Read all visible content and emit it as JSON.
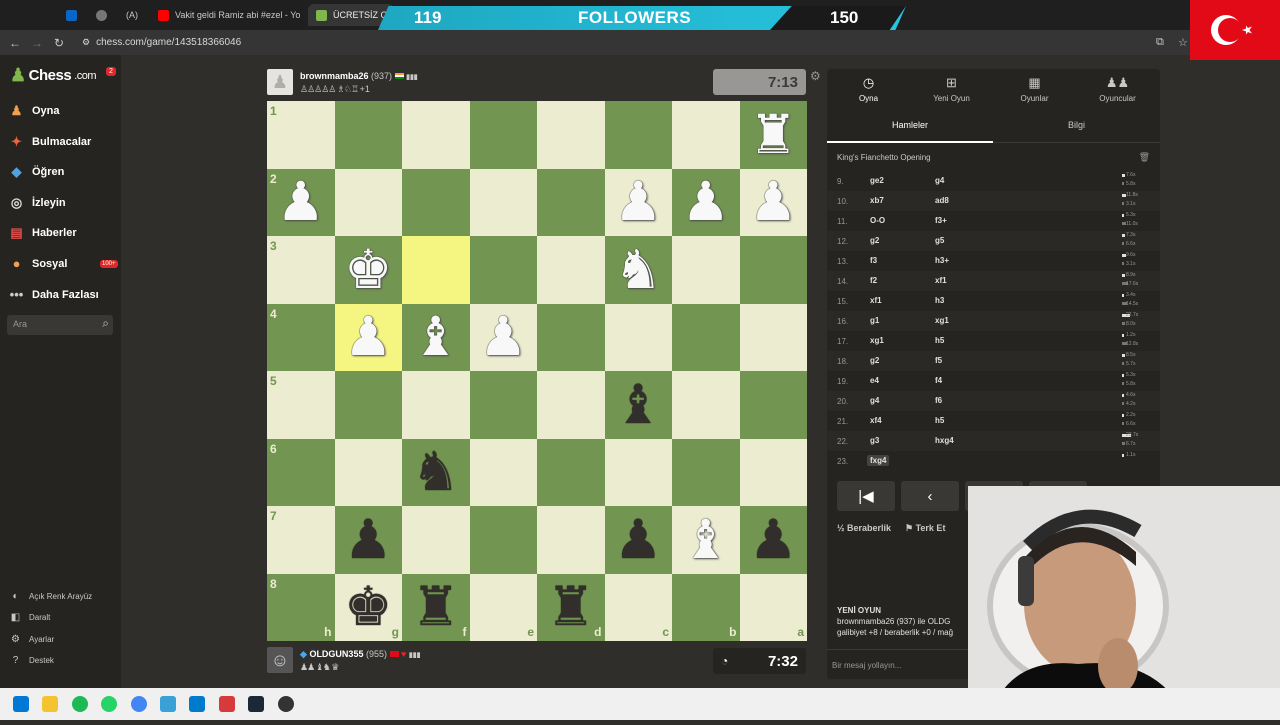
{
  "browser": {
    "tabs": [
      {
        "label": "",
        "icon": "linkedin-icon",
        "color": "#0a66c2"
      },
      {
        "label": "",
        "icon": "globe-icon",
        "color": "#777777"
      },
      {
        "label": "(A)",
        "icon": "app-icon",
        "color": "#6d4cc2"
      },
      {
        "label": "Vakit geldi Ramiz abi #ezel - Yo",
        "icon": "youtube-icon",
        "color": "#ff0000"
      },
      {
        "label": "ÜCRETSİZ Çevrimiçi",
        "icon": "chess-icon",
        "color": "#81b64c"
      }
    ],
    "url": "chess.com/game/143518366046"
  },
  "overlay": {
    "left_count": "119",
    "title": "FOLLOWERS",
    "right_count": "150"
  },
  "sidebar": {
    "logo_text": "Chess",
    "logo_suffix": ".com",
    "notification_count": "2",
    "items": [
      {
        "label": "Oyna",
        "icon": "play-icon"
      },
      {
        "label": "Bulmacalar",
        "icon": "puzzle-icon"
      },
      {
        "label": "Öğren",
        "icon": "learn-icon"
      },
      {
        "label": "İzleyin",
        "icon": "binoculars-icon"
      },
      {
        "label": "Haberler",
        "icon": "news-icon"
      },
      {
        "label": "Sosyal",
        "icon": "social-icon"
      },
      {
        "label": "Daha Fazlası",
        "icon": "more-icon"
      }
    ],
    "social_badge": "100+",
    "search_placeholder": "Ara",
    "bottom": [
      {
        "label": "Açık Renk Arayüz",
        "icon": "theme-icon"
      },
      {
        "label": "Daralt",
        "icon": "collapse-icon"
      },
      {
        "label": "Ayarlar",
        "icon": "settings-icon"
      },
      {
        "label": "Destek",
        "icon": "help-icon"
      }
    ]
  },
  "top_player": {
    "name": "brownmamba26",
    "rating": "(937)",
    "captured_suffix": "+1",
    "clock": "7:13"
  },
  "bottom_player": {
    "name": "OLDGUN355",
    "rating": "(955)",
    "clock": "7:32"
  },
  "board": {
    "ranks": [
      "1",
      "2",
      "3",
      "4",
      "5",
      "6",
      "7",
      "8"
    ],
    "files": [
      "h",
      "g",
      "f",
      "e",
      "d",
      "c",
      "b",
      "a"
    ],
    "highlight_color": "#f5f682",
    "light_color": "#ebecd0",
    "dark_color": "#739552",
    "pieces": [
      {
        "square": "a1",
        "piece": "R",
        "color": "white"
      },
      {
        "square": "c2",
        "piece": "P",
        "color": "white"
      },
      {
        "square": "b2",
        "piece": "P",
        "color": "white"
      },
      {
        "square": "a2",
        "piece": "P",
        "color": "white"
      },
      {
        "square": "h2",
        "piece": "P",
        "color": "white"
      },
      {
        "square": "g3",
        "piece": "K",
        "color": "white"
      },
      {
        "square": "c3",
        "piece": "N",
        "color": "white"
      },
      {
        "square": "g4",
        "piece": "P",
        "color": "white"
      },
      {
        "square": "f4",
        "piece": "B",
        "color": "white"
      },
      {
        "square": "e4",
        "piece": "P",
        "color": "white"
      },
      {
        "square": "c5",
        "piece": "B",
        "color": "black"
      },
      {
        "square": "f6",
        "piece": "N",
        "color": "black"
      },
      {
        "square": "g7",
        "piece": "P",
        "color": "black"
      },
      {
        "square": "c7",
        "piece": "P",
        "color": "black"
      },
      {
        "square": "b7",
        "piece": "B",
        "color": "white"
      },
      {
        "square": "a7",
        "piece": "P",
        "color": "black"
      },
      {
        "square": "g8",
        "piece": "K",
        "color": "black"
      },
      {
        "square": "f8",
        "piece": "R",
        "color": "black"
      },
      {
        "square": "d8",
        "piece": "R",
        "color": "black"
      }
    ],
    "highlights": [
      "f3",
      "g4"
    ]
  },
  "panel": {
    "tabs": [
      {
        "label": "Oyna",
        "icon": "play-tab-icon"
      },
      {
        "label": "Yeni Oyun",
        "icon": "new-game-icon"
      },
      {
        "label": "Oyunlar",
        "icon": "games-icon"
      },
      {
        "label": "Oyuncular",
        "icon": "players-icon"
      }
    ],
    "subtabs": [
      "Hamleler",
      "Bilgi"
    ],
    "opening": "King's Fianchetto Opening",
    "moves": [
      {
        "num": "9.",
        "white": "ge2",
        "black": "g4",
        "wt": "7.6s",
        "bt": "5.8s",
        "wbar": 0.2,
        "bbar": 0.15
      },
      {
        "num": "10.",
        "white": "xb7",
        "black": "ad8",
        "wt": "11.8s",
        "bt": "3.1s",
        "wbar": 0.3,
        "bbar": 0.08
      },
      {
        "num": "11.",
        "white": "O-O",
        "black": "f3+",
        "wt": "5.3s",
        "bt": "11.0s",
        "wbar": 0.14,
        "bbar": 0.29
      },
      {
        "num": "12.",
        "white": "g2",
        "black": "g5",
        "wt": "7.3s",
        "bt": "6.6s",
        "wbar": 0.19,
        "bbar": 0.17
      },
      {
        "num": "13.",
        "white": "f3",
        "black": "h3+",
        "wt": "9.6s",
        "bt": "3.1s",
        "wbar": 0.25,
        "bbar": 0.08
      },
      {
        "num": "14.",
        "white": "f2",
        "black": "xf1",
        "wt": "8.9s",
        "bt": "17.6s",
        "wbar": 0.23,
        "bbar": 0.46
      },
      {
        "num": "15.",
        "white": "xf1",
        "black": "h3",
        "wt": "3.4s",
        "bt": "14.5s",
        "wbar": 0.09,
        "bbar": 0.38
      },
      {
        "num": "16.",
        "white": "g1",
        "black": "xg1",
        "wt": "22.7s",
        "bt": "8.0s",
        "wbar": 0.6,
        "bbar": 0.21
      },
      {
        "num": "17.",
        "white": "xg1",
        "black": "h5",
        "wt": "1.2s",
        "bt": "12.8s",
        "wbar": 0.03,
        "bbar": 0.34
      },
      {
        "num": "18.",
        "white": "g2",
        "black": "f5",
        "wt": "8.5s",
        "bt": "5.7s",
        "wbar": 0.22,
        "bbar": 0.15
      },
      {
        "num": "19.",
        "white": "e4",
        "black": "f4",
        "wt": "5.3s",
        "bt": "5.8s",
        "wbar": 0.14,
        "bbar": 0.15
      },
      {
        "num": "20.",
        "white": "g4",
        "black": "f6",
        "wt": "4.6s",
        "bt": "4.2s",
        "wbar": 0.12,
        "bbar": 0.11
      },
      {
        "num": "21.",
        "white": "xf4",
        "black": "h5",
        "wt": "2.2s",
        "bt": "6.6s",
        "wbar": 0.06,
        "bbar": 0.17
      },
      {
        "num": "22.",
        "white": "g3",
        "black": "hxg4",
        "wt": "23.7s",
        "bt": "6.7s",
        "wbar": 0.62,
        "bbar": 0.18
      },
      {
        "num": "23.",
        "white": "fxg4",
        "black": "",
        "wt": "1.1s",
        "bt": "",
        "wbar": 0.03,
        "bbar": 0
      }
    ],
    "draw_label": "Beraberlik",
    "resign_label": "Terk Et",
    "new_game": {
      "heading": "YENİ OYUN",
      "line1": "brownmamba26 (937) ile OLDG",
      "line2": "galibiyet +8 / beraberlik +0 / mağ"
    },
    "message_placeholder": "Bir mesaj yollayın..."
  }
}
